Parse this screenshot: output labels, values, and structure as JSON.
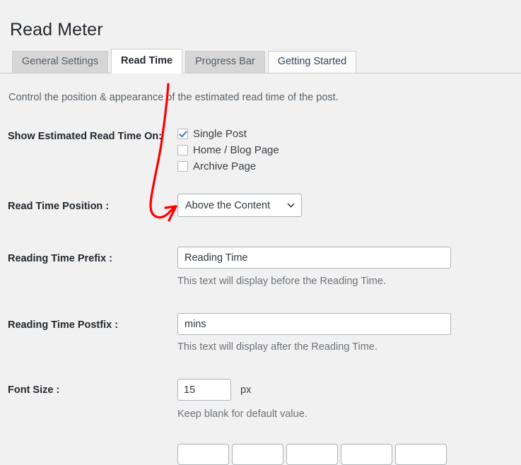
{
  "page": {
    "title": "Read Meter",
    "description": "Control the position & appearance of the estimated read time of the post."
  },
  "tabs": [
    {
      "label": "General Settings",
      "state": "inactive"
    },
    {
      "label": "Read Time",
      "state": "active"
    },
    {
      "label": "Progress Bar",
      "state": "inactive"
    },
    {
      "label": "Getting Started",
      "state": "inactive-light"
    }
  ],
  "fields": {
    "show_on": {
      "label": "Show Estimated Read Time On:",
      "options": [
        {
          "label": "Single Post",
          "checked": true
        },
        {
          "label": "Home / Blog Page",
          "checked": false
        },
        {
          "label": "Archive Page",
          "checked": false
        }
      ]
    },
    "position": {
      "label": "Read Time Position :",
      "selected": "Above the Content",
      "icon": "chevron-down-icon"
    },
    "prefix": {
      "label": "Reading Time Prefix :",
      "value": "Reading Time",
      "help": "This text will display before the Reading Time."
    },
    "postfix": {
      "label": "Reading Time Postfix :",
      "value": "mins",
      "help": "This text will display after the Reading Time."
    },
    "font_size": {
      "label": "Font Size :",
      "value": "15",
      "unit": "px",
      "help": "Keep blank for default value."
    }
  },
  "annotation": {
    "color": "#fe0000",
    "shape": "curved-arrow-pointing-to-read-time-position-dropdown"
  }
}
